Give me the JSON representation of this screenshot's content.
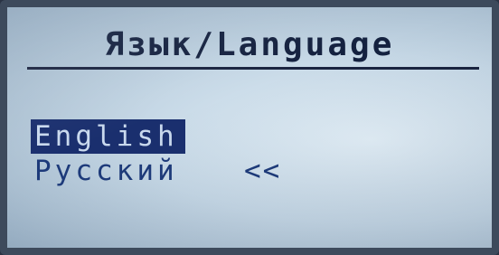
{
  "screen": {
    "title": "Язык/Language",
    "options": [
      {
        "label": "English",
        "selected": true,
        "marker": ""
      },
      {
        "label": "Русский",
        "selected": false,
        "marker": "<<"
      }
    ],
    "colors": {
      "text": "#1d3a7a",
      "title": "#14213f",
      "highlight": "#1a2f6e",
      "background": "#c6d8e6"
    }
  }
}
